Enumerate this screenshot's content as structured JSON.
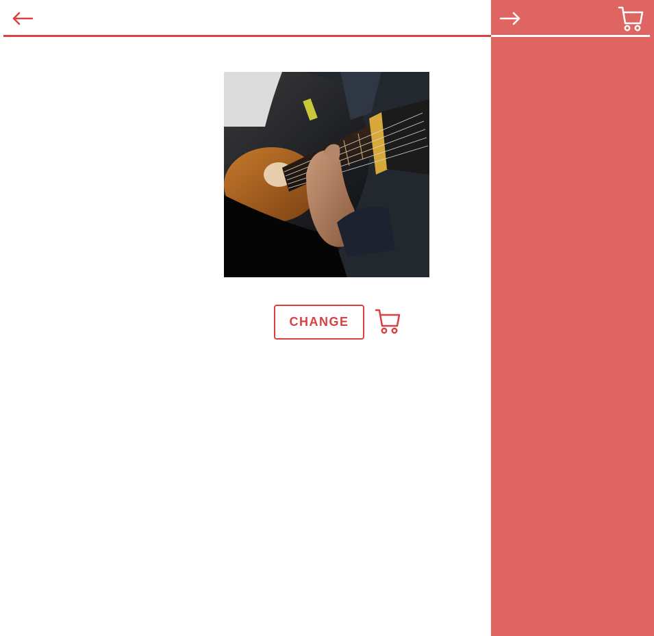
{
  "header": {
    "back_icon": "arrow-left-icon"
  },
  "product": {
    "image_icon": "guitar-photo",
    "change_label": "CHANGE",
    "cart_icon": "cart-icon"
  },
  "side_panel": {
    "forward_icon": "arrow-right-icon",
    "cart_icon": "cart-icon"
  },
  "colors": {
    "accent": "#d9403f",
    "panel": "#de6562",
    "background": "#ffffff"
  }
}
